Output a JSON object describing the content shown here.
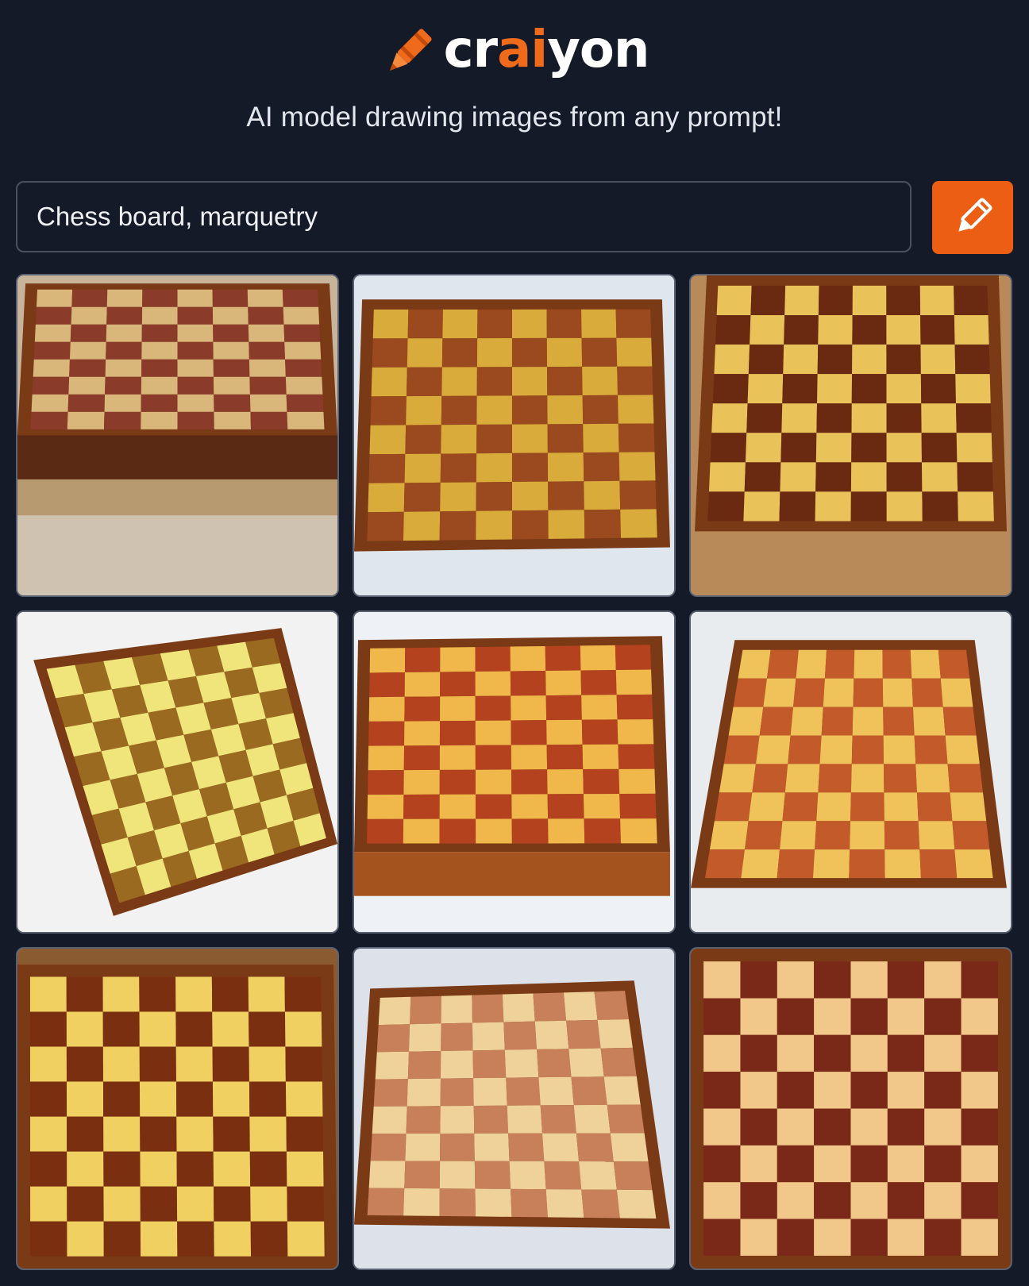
{
  "app": {
    "brand_prefix": "cr",
    "brand_accent": "ai",
    "brand_suffix": "yon",
    "tagline": "AI model drawing images from any prompt!"
  },
  "search": {
    "value": "Chess board, marquetry",
    "button_icon": "pencil-icon"
  },
  "colors": {
    "background": "#141a28",
    "accent": "#ec5e13",
    "text": "#e6e8ee"
  },
  "results": [
    {
      "style": "box-with-carved-drawer",
      "light": "#d9b77a",
      "dark": "#8a3b2a",
      "bg": "#c8b49a"
    },
    {
      "style": "tilted-board-ornate-border",
      "light": "#d9ab3a",
      "dark": "#9a4a1e",
      "bg": "#dfe6ee"
    },
    {
      "style": "board-with-pieces-row",
      "light": "#e9c35a",
      "dark": "#6a2a12",
      "bg": "#b88a5a"
    },
    {
      "style": "warped-board",
      "light": "#efe57a",
      "dark": "#9a6a20",
      "bg": "#f2f2f2"
    },
    {
      "style": "board-front-edge",
      "light": "#f0b84a",
      "dark": "#b4421e",
      "bg": "#eef2f6"
    },
    {
      "style": "board-perspective",
      "light": "#f0c25a",
      "dark": "#c25a2a",
      "bg": "#e8ecef"
    },
    {
      "style": "board-with-pieces",
      "light": "#f0d060",
      "dark": "#7a3010",
      "bg": "#8a5a30"
    },
    {
      "style": "pale-woven-board",
      "light": "#efd29a",
      "dark": "#c7805a",
      "bg": "#dde2ea"
    },
    {
      "style": "closeup-board",
      "light": "#f2c88a",
      "dark": "#7a2818",
      "bg": "#b07040"
    }
  ]
}
